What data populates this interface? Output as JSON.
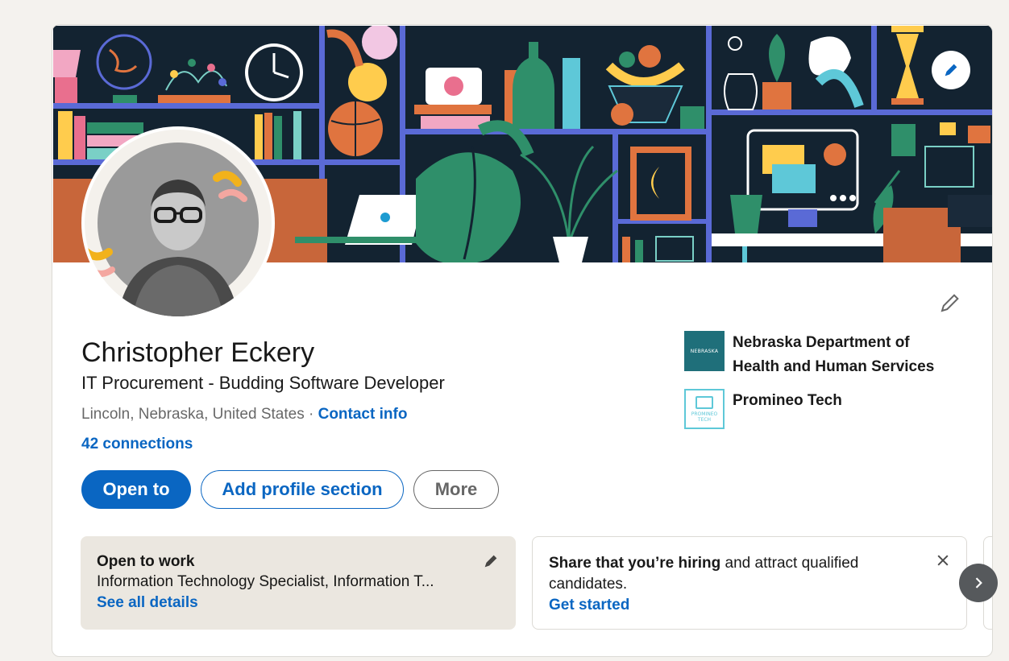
{
  "profile": {
    "name": "Christopher Eckery",
    "headline": "IT Procurement - Budding Software Developer",
    "location": "Lincoln, Nebraska, United States",
    "separator": " · ",
    "contact_info_label": "Contact info",
    "connections_label": "42 connections"
  },
  "actions": {
    "open_to_label": "Open to",
    "add_section_label": "Add profile section",
    "more_label": "More"
  },
  "experience": [
    {
      "name": "Nebraska Department of Health and Human Services",
      "logo_text": "NEBRASKA",
      "logo_color": "#1f6f7a"
    },
    {
      "name": "Promineo Tech",
      "logo_text": "PROMINEO TECH",
      "logo_color": "#5ec8d8"
    }
  ],
  "open_to_work": {
    "title": "Open to work",
    "roles": "Information Technology Specialist, Information T...",
    "link_label": "See all details"
  },
  "hiring": {
    "strong_text": "Share that you’re hiring",
    "rest_text": " and attract qualified candidates.",
    "link_label": "Get started"
  },
  "icons": {
    "banner_edit": "pencil-icon",
    "intro_edit": "pencil-icon",
    "open_to_work_edit": "pencil-icon",
    "hiring_close": "close-icon",
    "carousel_next": "chevron-right-icon"
  },
  "colors": {
    "brand_blue": "#0a66c2",
    "banner_bg": "#132331",
    "open_to_work_bg": "#ebe7e0"
  }
}
